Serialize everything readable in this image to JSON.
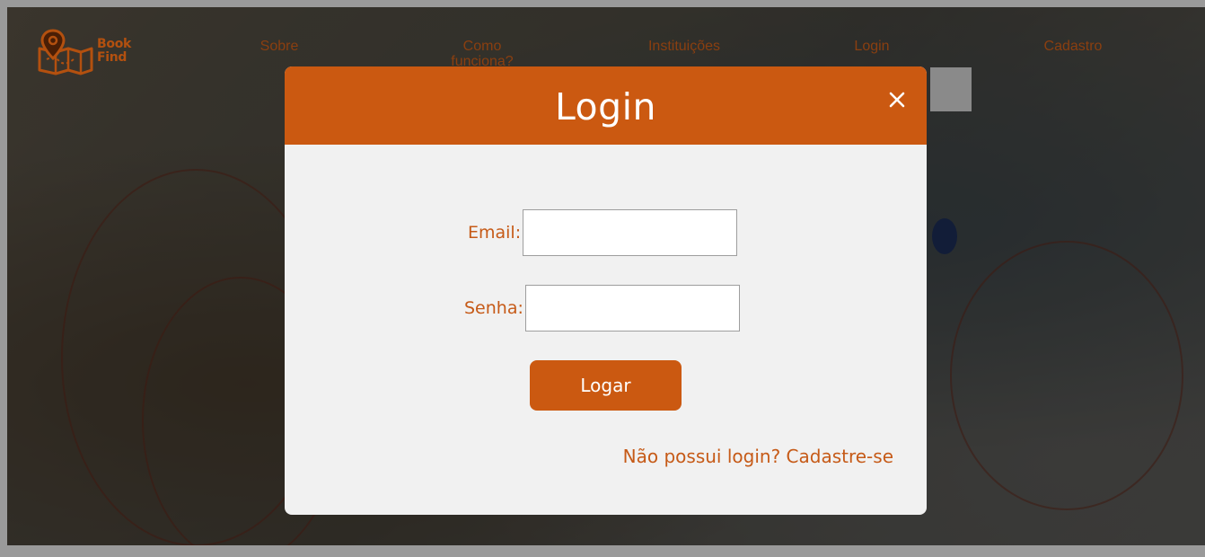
{
  "brand": {
    "line1": "Book",
    "line2": "Find",
    "color": "#b3500f",
    "logo_icon": "map-pin-book-icon"
  },
  "nav": {
    "items": [
      {
        "label": "Sobre"
      },
      {
        "label": "Como funciona?"
      },
      {
        "label": "Instituições"
      },
      {
        "label": "Login"
      },
      {
        "label": "Cadastro"
      }
    ]
  },
  "modal": {
    "title": "Login",
    "close_icon": "close-icon",
    "email_label": "Email:",
    "email_value": "",
    "password_label": "Senha:",
    "password_value": "",
    "submit_label": "Logar",
    "signup_link": "Não possui login? Cadastre-se"
  },
  "colors": {
    "accent": "#cb5911",
    "label_text": "#c65a17",
    "modal_background": "#f1f1f1"
  }
}
